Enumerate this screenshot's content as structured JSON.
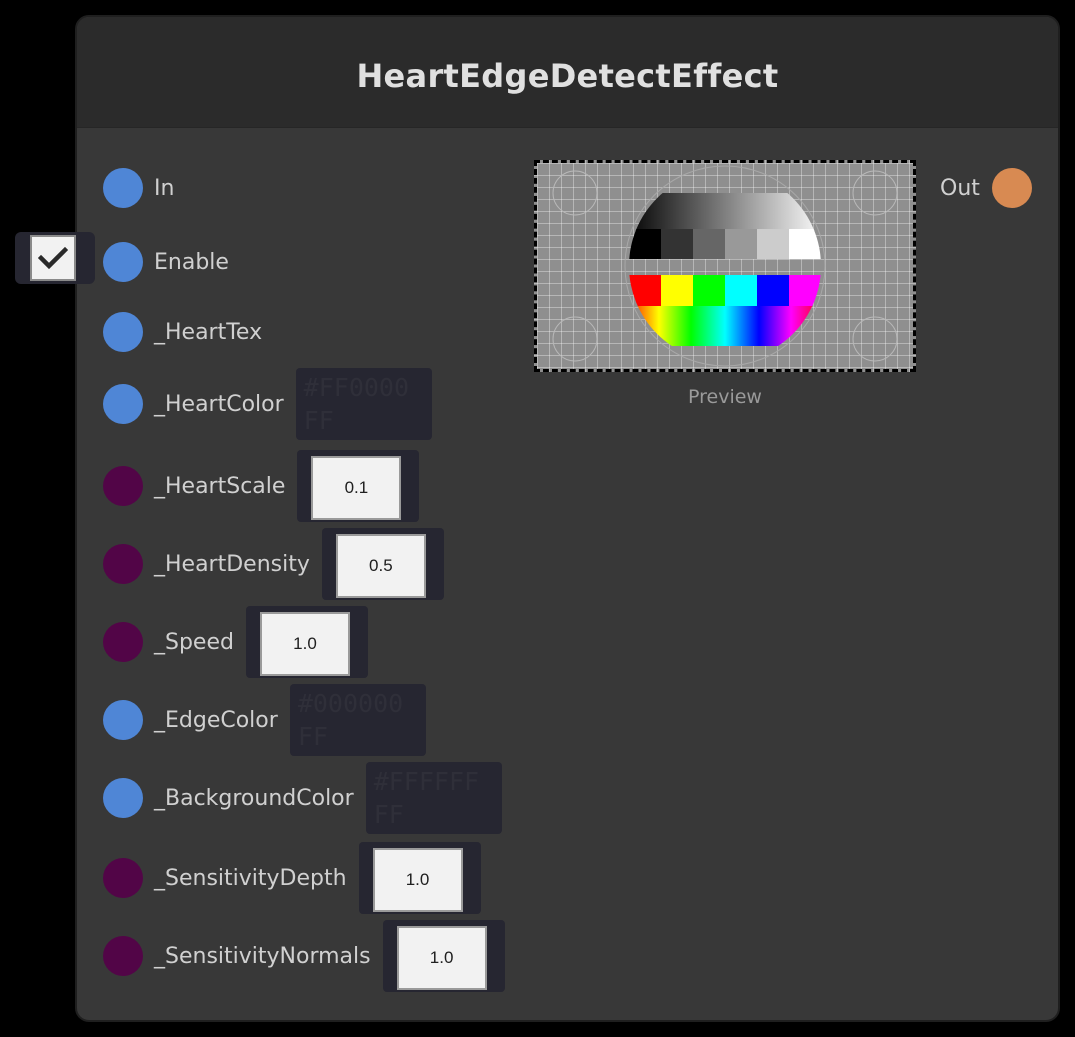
{
  "node": {
    "title": "HeartEdgeDetectEffect"
  },
  "colors": {
    "texture_port": "#4f86d6",
    "float_port": "#520547",
    "output_port": "#d88a52",
    "node_bg": "#383838",
    "header_bg": "#2b2b2b"
  },
  "inputs": [
    {
      "label": "In",
      "kind": "texture"
    },
    {
      "label": "Enable",
      "kind": "bool",
      "checked": true
    },
    {
      "label": "_HeartTex",
      "kind": "texture"
    },
    {
      "label": "_HeartColor",
      "kind": "color",
      "value": "#FF0000FF"
    },
    {
      "label": "_HeartScale",
      "kind": "float",
      "value": "0.1"
    },
    {
      "label": "_HeartDensity",
      "kind": "float",
      "value": "0.5"
    },
    {
      "label": "_Speed",
      "kind": "float",
      "value": "1.0"
    },
    {
      "label": "_EdgeColor",
      "kind": "color",
      "value": "#000000FF"
    },
    {
      "label": "_BackgroundColor",
      "kind": "color",
      "value": "#FFFFFFFF"
    },
    {
      "label": "_SensitivityDepth",
      "kind": "float",
      "value": "1.0"
    },
    {
      "label": "_SensitivityNormals",
      "kind": "float",
      "value": "1.0"
    }
  ],
  "output": {
    "label": "Out"
  },
  "preview": {
    "caption": "Preview",
    "gray_steps": [
      "#000000",
      "#333333",
      "#666666",
      "#999999",
      "#cccccc",
      "#ffffff"
    ],
    "color_bars": [
      "#ff0000",
      "#ffff00",
      "#00ff00",
      "#00ffff",
      "#0000ff",
      "#ff00ff"
    ]
  }
}
